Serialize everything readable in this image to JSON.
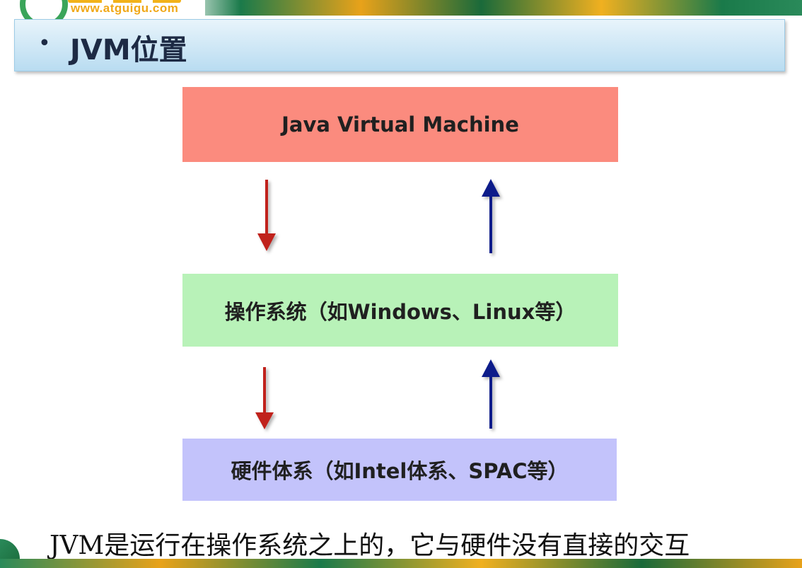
{
  "header": {
    "logo_url": "www.atguigu.com"
  },
  "slide": {
    "bullet": "•",
    "title": "JVM位置"
  },
  "diagram": {
    "jvm_label": "Java Virtual Machine",
    "os_label": "操作系统（如Windows、Linux等）",
    "hardware_label": "硬件体系（如Intel体系、SPAC等）"
  },
  "caption": "JVM是运行在操作系统之上的，它与硬件没有直接的交互",
  "colors": {
    "jvm_box": "#fb8b7e",
    "os_box": "#b8f2b8",
    "hardware_box": "#c3c3fb",
    "down_arrow": "#c0201c",
    "up_arrow": "#0a1a8a",
    "title_bar": "#b9dcf1"
  }
}
